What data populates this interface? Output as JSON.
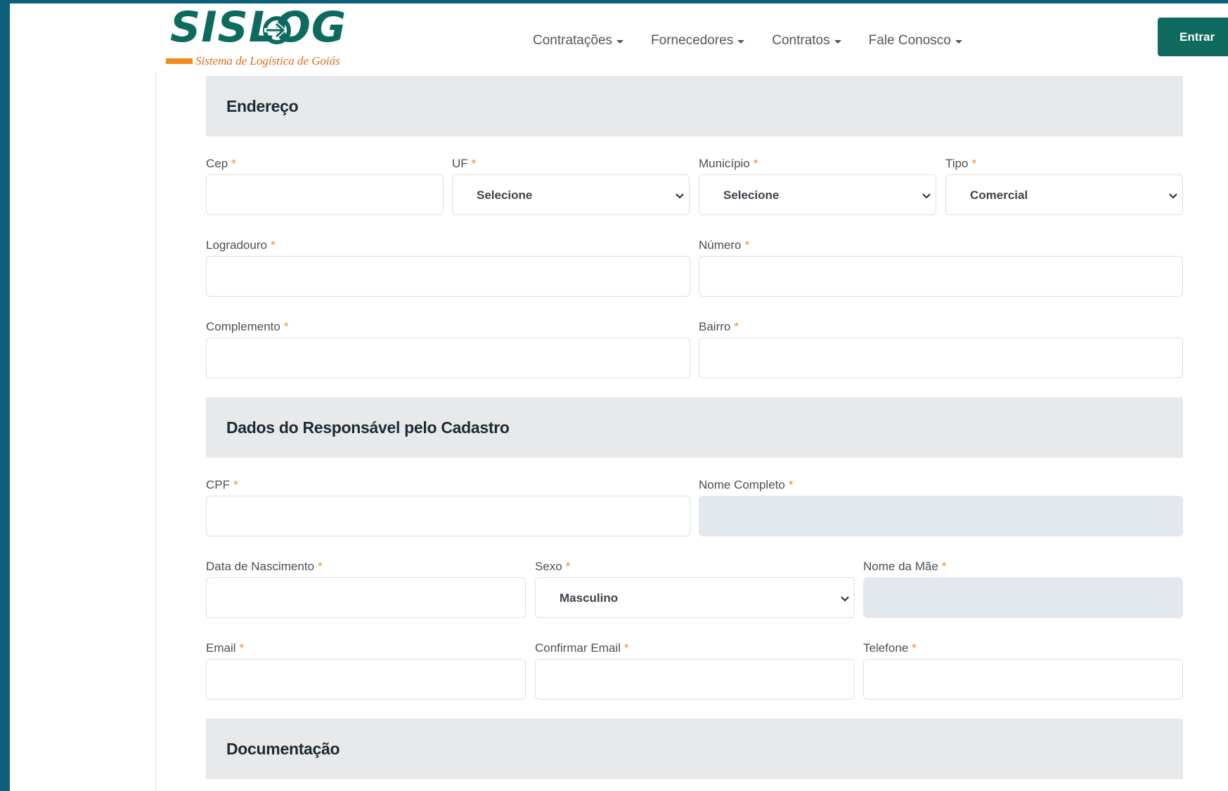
{
  "header": {
    "logo_text": "SISLOG",
    "logo_subtitle": "Sistema de Logística de Goiás",
    "nav": [
      {
        "label": "Contratações"
      },
      {
        "label": "Fornecedores"
      },
      {
        "label": "Contratos"
      },
      {
        "label": "Fale Conosco"
      }
    ],
    "login_label": "Entrar"
  },
  "colors": {
    "brand_green": "#0f6a60",
    "accent_orange": "#f08a1c",
    "section_bg": "#e8e9eb",
    "disabled_input": "#e3e8ef",
    "page_bg": "#0c6079"
  },
  "icons": {
    "nav_dropdown": "caret-down-icon",
    "select_arrow": "chevron-down-icon",
    "logo_arrow": "arrow-right-icon"
  },
  "required_marker": "*",
  "sections": {
    "endereco": {
      "title": "Endereço",
      "fields": {
        "cep": {
          "label": "Cep",
          "value": ""
        },
        "uf": {
          "label": "UF",
          "value": "Selecione"
        },
        "municipio": {
          "label": "Município",
          "value": "Selecione"
        },
        "tipo": {
          "label": "Tipo",
          "value": "Comercial"
        },
        "logradouro": {
          "label": "Logradouro",
          "value": ""
        },
        "numero": {
          "label": "Número",
          "value": ""
        },
        "complemento": {
          "label": "Complemento",
          "value": ""
        },
        "bairro": {
          "label": "Bairro",
          "value": ""
        }
      }
    },
    "responsavel": {
      "title": "Dados do Responsável pelo Cadastro",
      "fields": {
        "cpf": {
          "label": "CPF",
          "value": ""
        },
        "nome": {
          "label": "Nome Completo",
          "value": ""
        },
        "nascimento": {
          "label": "Data de Nascimento",
          "value": ""
        },
        "sexo": {
          "label": "Sexo",
          "value": "Masculino"
        },
        "mae": {
          "label": "Nome da Mãe",
          "value": ""
        },
        "email": {
          "label": "Email",
          "value": ""
        },
        "confirmar_email": {
          "label": "Confirmar Email",
          "value": ""
        },
        "telefone": {
          "label": "Telefone",
          "value": ""
        }
      }
    },
    "documentacao": {
      "title": "Documentação"
    }
  }
}
